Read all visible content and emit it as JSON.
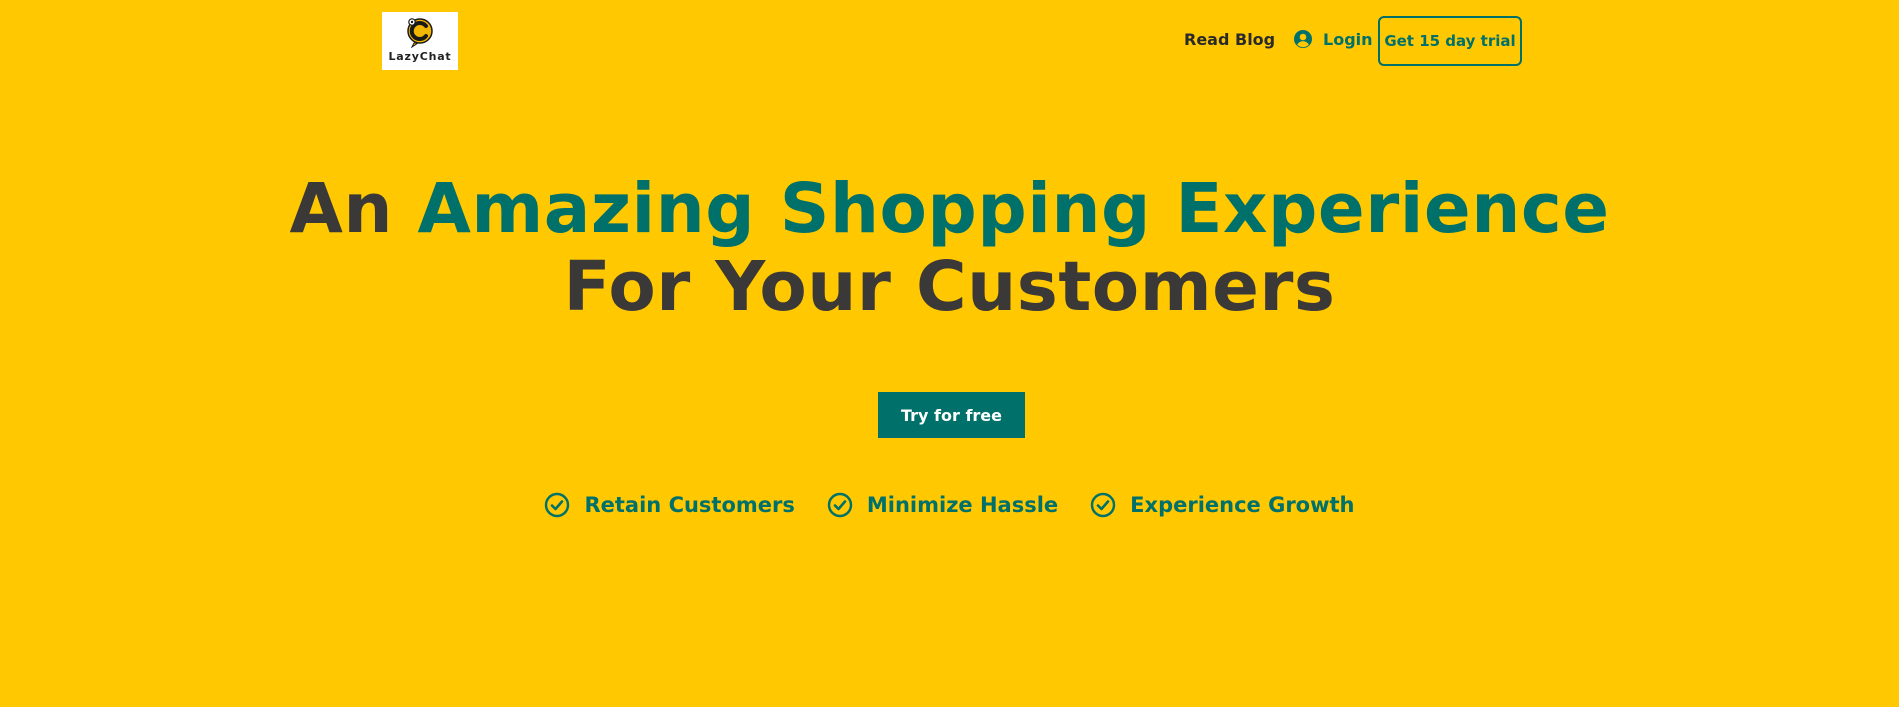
{
  "brand": {
    "logo_text": "LazyChat"
  },
  "nav": {
    "blog_label": "Read Blog",
    "login_label": "Login",
    "trial_label": "Get 15 day trial"
  },
  "hero": {
    "title_prefix": "An ",
    "title_accent": "Amazing Shopping Experience",
    "title_line2": "For Your Customers",
    "cta_label": "Try for free"
  },
  "features": [
    {
      "label": "Retain Customers",
      "icon": "check-circle-icon"
    },
    {
      "label": "Minimize Hassle",
      "icon": "check-circle-icon"
    },
    {
      "label": "Experience Growth",
      "icon": "check-circle-icon"
    }
  ],
  "colors": {
    "background": "#FFC800",
    "accent": "#00706A",
    "dark_text": "#3B3838"
  }
}
